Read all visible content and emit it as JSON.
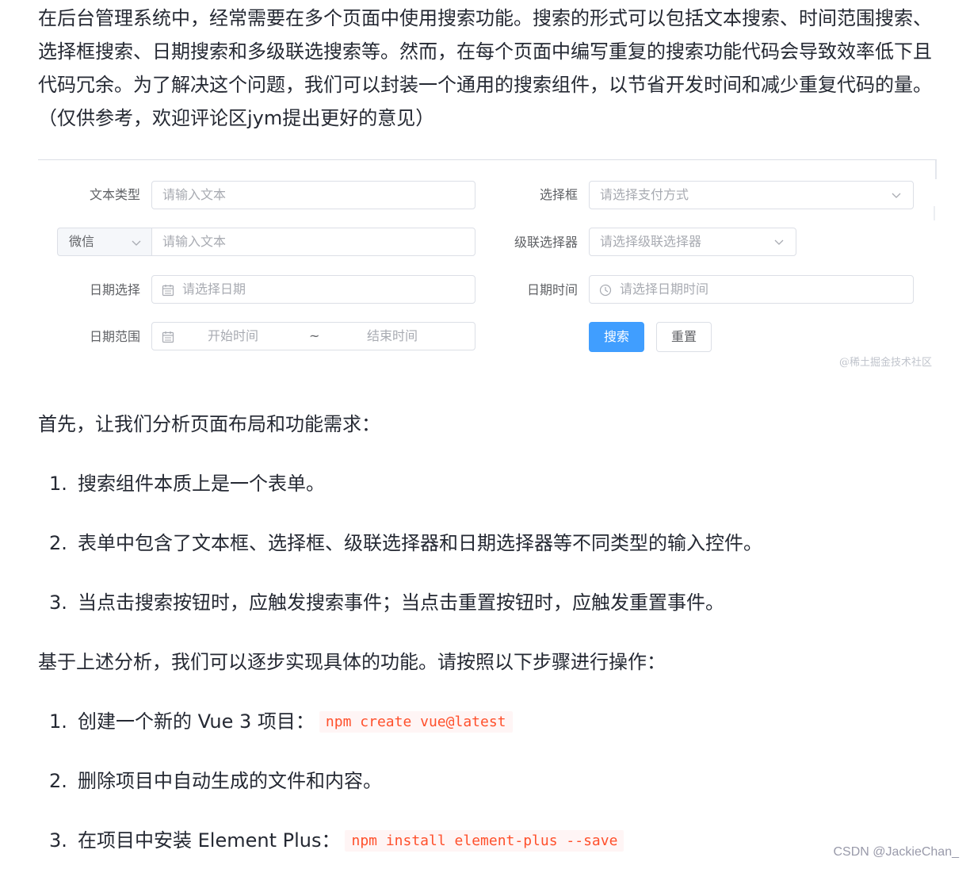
{
  "intro": "在后台管理系统中，经常需要在多个页面中使用搜索功能。搜索的形式可以包括文本搜索、时间范围搜索、选择框搜索、日期搜索和多级联选搜索等。然而，在每个页面中编写重复的搜索功能代码会导致效率低下且代码冗余。为了解决这个问题，我们可以封装一个通用的搜索组件，以节省开发时间和减少重复代码的量。（仅供参考，欢迎评论区jym提出更好的意见）",
  "form": {
    "text_type": {
      "label": "文本类型",
      "placeholder": "请输入文本"
    },
    "wechat": {
      "prepend": "微信",
      "placeholder": "请输入文本"
    },
    "date_select": {
      "label": "日期选择",
      "placeholder": "请选择日期"
    },
    "date_range": {
      "label": "日期范围",
      "start": "开始时间",
      "separator": "~",
      "end": "结束时间"
    },
    "select_box": {
      "label": "选择框",
      "placeholder": "请选择支付方式"
    },
    "cascader": {
      "label": "级联选择器",
      "placeholder": "请选择级联选择器"
    },
    "datetime": {
      "label": "日期时间",
      "placeholder": "请选择日期时间"
    },
    "search_button": "搜索",
    "reset_button": "重置",
    "watermark": "@稀土掘金技术社区"
  },
  "analysis": {
    "lead": "首先，让我们分析页面布局和功能需求：",
    "items": [
      {
        "num": "1.",
        "text": "搜索组件本质上是一个表单。"
      },
      {
        "num": "2.",
        "text": "表单中包含了文本框、选择框、级联选择器和日期选择器等不同类型的输入控件。"
      },
      {
        "num": "3.",
        "text": "当点击搜索按钮时，应触发搜索事件；当点击重置按钮时，应触发重置事件。"
      }
    ]
  },
  "steps": {
    "lead": "基于上述分析，我们可以逐步实现具体的功能。请按照以下步骤进行操作：",
    "items": [
      {
        "num": "1.",
        "text": "创建一个新的 Vue 3 项目：",
        "code": "npm create vue@latest"
      },
      {
        "num": "2.",
        "text": "删除项目中自动生成的文件和内容。",
        "code": ""
      },
      {
        "num": "3.",
        "text": "在项目中安装 Element Plus：",
        "code": "npm install element-plus --save"
      }
    ]
  },
  "csdn_watermark": "CSDN @JackieChan_",
  "colors": {
    "primary": "#409eff",
    "code_text": "#ff502c",
    "code_bg": "#fff5f5"
  }
}
